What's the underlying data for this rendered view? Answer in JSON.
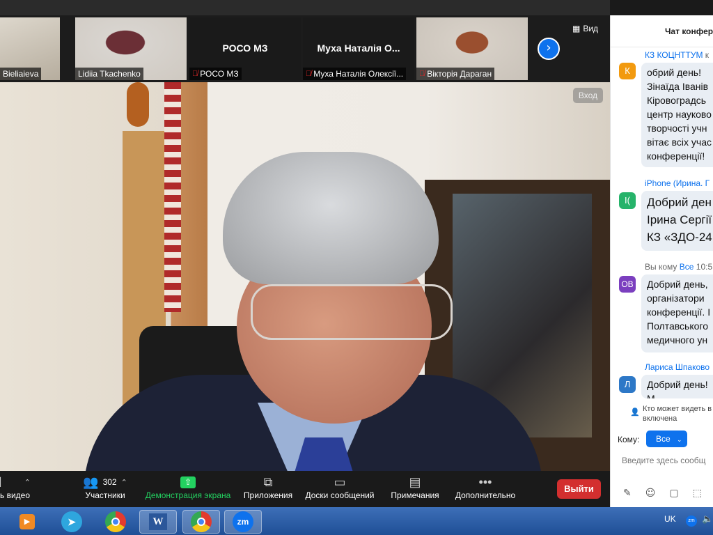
{
  "gallery": {
    "tiles": [
      {
        "name": "Bieliaieva",
        "center": "",
        "muted": false
      },
      {
        "name": "Lidiia Tkachenko",
        "center": "",
        "muted": false
      },
      {
        "name": "РОСО МЗ",
        "center": "РОСО МЗ",
        "muted": true
      },
      {
        "name": "Муха Наталія Олексії...",
        "center": "Муха  Наталія  О...",
        "muted": true
      },
      {
        "name": "Вікторія Дараган",
        "center": "",
        "muted": true
      }
    ],
    "next_icon": "chevron-right-icon",
    "view_label": "Вид"
  },
  "main": {
    "enter_label": "Вход"
  },
  "toolbar": {
    "video_label": "ь видео",
    "participants_label": "Участники",
    "participants_count": "302",
    "share_label": "Демонстрация экрана",
    "apps_label": "Приложения",
    "whiteboards_label": "Доски сообщений",
    "notes_label": "Примечания",
    "more_label": "Дополнительно",
    "exit_label": "Выйти",
    "share_color": "#23d160",
    "exit_color": "#d32f2f"
  },
  "chat": {
    "title": "Чат конфер",
    "messages": [
      {
        "sender": "КЗ КОЦНТТУМ",
        "sender_extra": "к",
        "avatar": "К",
        "avatar_color": "#f29a0f",
        "lines": [
          "обрий день!",
          "Зінаїда Іванів",
          "Кіровоградсь",
          "центр науково",
          "творчості учн",
          "вітає всіх учас",
          "конференції!"
        ]
      },
      {
        "sender": "iPhone (Ирина. Г",
        "sender_extra": "",
        "avatar": "I(",
        "avatar_color": "#26b36a",
        "lines": [
          "Добрий ден",
          "Ірина Сергії",
          "КЗ «ЗДО-24"
        ]
      },
      {
        "sender": "Вы кому",
        "sender_extra": "Все",
        "time": "10:5",
        "avatar": "OB",
        "avatar_color": "#7b3fbf",
        "lines": [
          "Добрий день,",
          "організатори",
          "конференції. І",
          "Полтавського",
          "медичного ун"
        ]
      },
      {
        "sender": "Лариса Шпаково",
        "sender_extra": "",
        "avatar": "Л",
        "avatar_color": "#2d78c7",
        "lines": [
          "Добрий день!",
          "М"
        ]
      }
    ],
    "who_can_see": [
      "Кто может видеть в",
      "включена"
    ],
    "to_label": "Кому:",
    "to_value": "Все",
    "input_placeholder": "Введите здесь сообщ"
  },
  "taskbar": {
    "items": [
      {
        "name": "media-player",
        "label": ""
      },
      {
        "name": "telegram",
        "label": ""
      },
      {
        "name": "chrome",
        "label": ""
      },
      {
        "name": "word",
        "label": "W"
      },
      {
        "name": "chrome-profile",
        "label": ""
      },
      {
        "name": "zoom",
        "label": "zm"
      }
    ],
    "language": "UK",
    "tray_zoom": "zm"
  }
}
